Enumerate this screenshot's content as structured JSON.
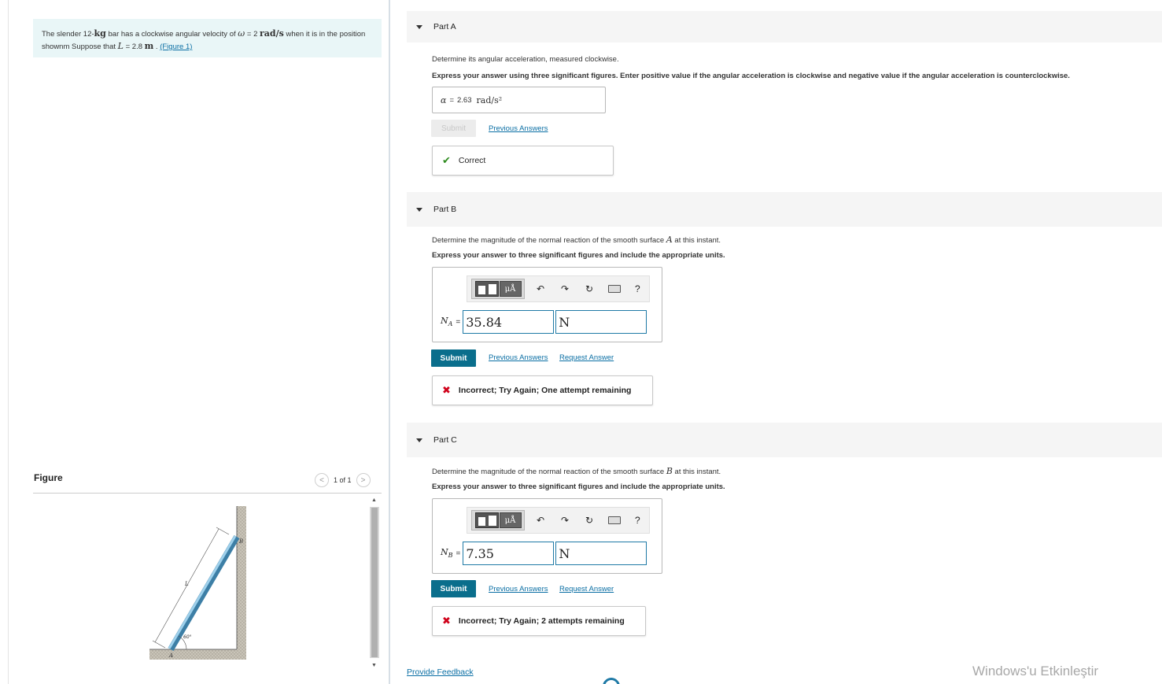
{
  "problem": {
    "text_1": "The slender 12-",
    "mass_unit": "kg",
    "text_2": " bar has a clockwise angular velocity of ",
    "omega": "ω",
    "text_3": " = 2 ",
    "omega_unit": "rad/s",
    "text_4": " when it is in the position shownm Suppose that ",
    "L": "L",
    "text_5": " = 2.8 ",
    "L_unit": "m",
    "text_6": " . ",
    "figure_link": "(Figure 1)"
  },
  "figure": {
    "title": "Figure",
    "pager": "1 of 1",
    "prev_glyph": "<",
    "next_glyph": ">",
    "label_L": "L",
    "label_A": "A",
    "label_B": "B",
    "label_angle": "60°"
  },
  "part_a": {
    "header": "Part A",
    "question": "Determine its angular acceleration, measured clockwise.",
    "instruction": "Express your answer using three significant figures. Enter positive value if the angular acceleration is clockwise and negative value if the angular acceleration is counterclockwise.",
    "answer_symbol": "α",
    "answer_eq": "=",
    "answer_value": "2.63",
    "answer_unit": "rad/s²",
    "submit_label": "Submit",
    "previous_answers": "Previous Answers",
    "feedback": "Correct"
  },
  "part_b": {
    "header": "Part B",
    "question_1": "Determine the magnitude of the normal reaction of the smooth surface ",
    "surface": "A",
    "question_2": " at this instant.",
    "instruction": "Express your answer to three significant figures and include the appropriate units.",
    "label_main": "N",
    "label_sub": "A",
    "eq": "=",
    "value": "35.84",
    "unit": "N",
    "submit_label": "Submit",
    "previous_answers": "Previous Answers",
    "request_answer": "Request Answer",
    "feedback": "Incorrect; Try Again; One attempt remaining"
  },
  "part_c": {
    "header": "Part C",
    "question_1": "Determine the magnitude of the normal reaction of the smooth surface ",
    "surface": "B",
    "question_2": " at this instant.",
    "instruction": "Express your answer to three significant figures and include the appropriate units.",
    "label_main": "N",
    "label_sub": "B",
    "eq": "=",
    "value": "7.35",
    "unit": "N",
    "submit_label": "Submit",
    "previous_answers": "Previous Answers",
    "request_answer": "Request Answer",
    "feedback": "Incorrect; Try Again; 2 attempts remaining"
  },
  "toolbar": {
    "mu_label": "μÅ",
    "undo_glyph": "↶",
    "redo_glyph": "↷",
    "reset_glyph": "↻",
    "help_glyph": "?",
    "icons": [
      "templates-icon",
      "units-icon",
      "undo-icon",
      "redo-icon",
      "reset-icon",
      "keyboard-icon",
      "help-icon"
    ]
  },
  "footer": {
    "provide_feedback": "Provide Feedback",
    "watermark": "Windows'u Etkinleştir"
  },
  "colors": {
    "accent": "#0a6e8c",
    "link": "#0b6fa4",
    "correct": "#2e8b1f",
    "incorrect": "#d0021b",
    "problem_bg": "#e9f6f7"
  }
}
